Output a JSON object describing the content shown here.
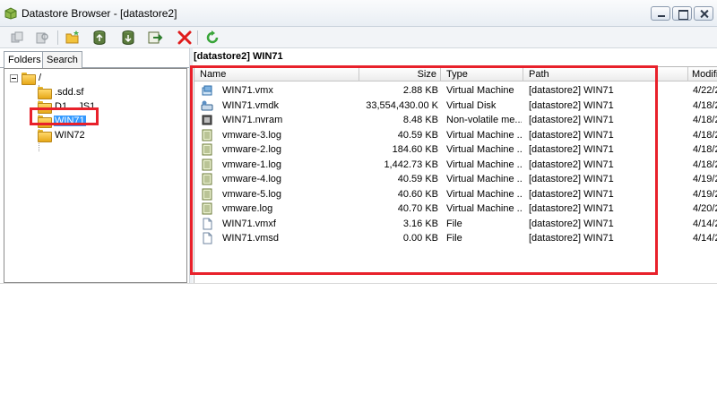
{
  "window": {
    "title": "Datastore Browser - [datastore2]",
    "buttons": {
      "minimize_icon": "minimize-icon",
      "maximize_icon": "maximize-icon",
      "close_icon": "close-icon"
    }
  },
  "toolbar": {
    "icons": [
      "move-icon",
      "browse-icon",
      "new-folder-icon",
      "upload-icon",
      "download-icon",
      "register-vm-icon",
      "delete-icon",
      "refresh-icon"
    ],
    "delete_color": "#e01b1b",
    "refresh_color": "#3aa53a"
  },
  "left": {
    "tabs": [
      {
        "label": "Folders"
      },
      {
        "label": "Search"
      }
    ],
    "tree": {
      "root": "/",
      "items": [
        {
          "label": ".sdd.sf"
        },
        {
          "label": "D1....JS1"
        },
        {
          "label": "WIN71"
        },
        {
          "label": "WIN72"
        }
      ]
    }
  },
  "main": {
    "path_title": "[datastore2] WIN71",
    "columns": [
      "Name",
      "Size",
      "Type",
      "Path",
      "Modifi"
    ],
    "rows": [
      {
        "name": "WIN71.vmx",
        "size": "2.88 KB",
        "type": "Virtual Machine",
        "path": "[datastore2] WIN71",
        "modified": "4/22/2",
        "icon": "vm-config-icon"
      },
      {
        "name": "WIN71.vmdk",
        "size": "33,554,430.00 K",
        "type": "Virtual Disk",
        "path": "[datastore2] WIN71",
        "modified": "4/18/2",
        "icon": "virtual-disk-icon"
      },
      {
        "name": "WIN71.nvram",
        "size": "8.48 KB",
        "type": "Non-volatile me...",
        "path": "[datastore2] WIN71",
        "modified": "4/18/2",
        "icon": "nvram-icon"
      },
      {
        "name": "vmware-3.log",
        "size": "40.59 KB",
        "type": "Virtual Machine ...",
        "path": "[datastore2] WIN71",
        "modified": "4/18/2",
        "icon": "log-file-icon"
      },
      {
        "name": "vmware-2.log",
        "size": "184.60 KB",
        "type": "Virtual Machine ...",
        "path": "[datastore2] WIN71",
        "modified": "4/18/2",
        "icon": "log-file-icon"
      },
      {
        "name": "vmware-1.log",
        "size": "1,442.73 KB",
        "type": "Virtual Machine ...",
        "path": "[datastore2] WIN71",
        "modified": "4/18/2",
        "icon": "log-file-icon"
      },
      {
        "name": "vmware-4.log",
        "size": "40.59 KB",
        "type": "Virtual Machine ...",
        "path": "[datastore2] WIN71",
        "modified": "4/19/2",
        "icon": "log-file-icon"
      },
      {
        "name": "vmware-5.log",
        "size": "40.60 KB",
        "type": "Virtual Machine ...",
        "path": "[datastore2] WIN71",
        "modified": "4/19/2",
        "icon": "log-file-icon"
      },
      {
        "name": "vmware.log",
        "size": "40.70 KB",
        "type": "Virtual Machine ...",
        "path": "[datastore2] WIN71",
        "modified": "4/20/2",
        "icon": "log-file-icon"
      },
      {
        "name": "WIN71.vmxf",
        "size": "3.16 KB",
        "type": "File",
        "path": "[datastore2] WIN71",
        "modified": "4/14/2",
        "icon": "file-icon"
      },
      {
        "name": "WIN71.vmsd",
        "size": "0.00 KB",
        "type": "File",
        "path": "[datastore2] WIN71",
        "modified": "4/14/2",
        "icon": "file-icon"
      }
    ]
  },
  "annotations": {
    "highlight_color": "#e8212b"
  }
}
